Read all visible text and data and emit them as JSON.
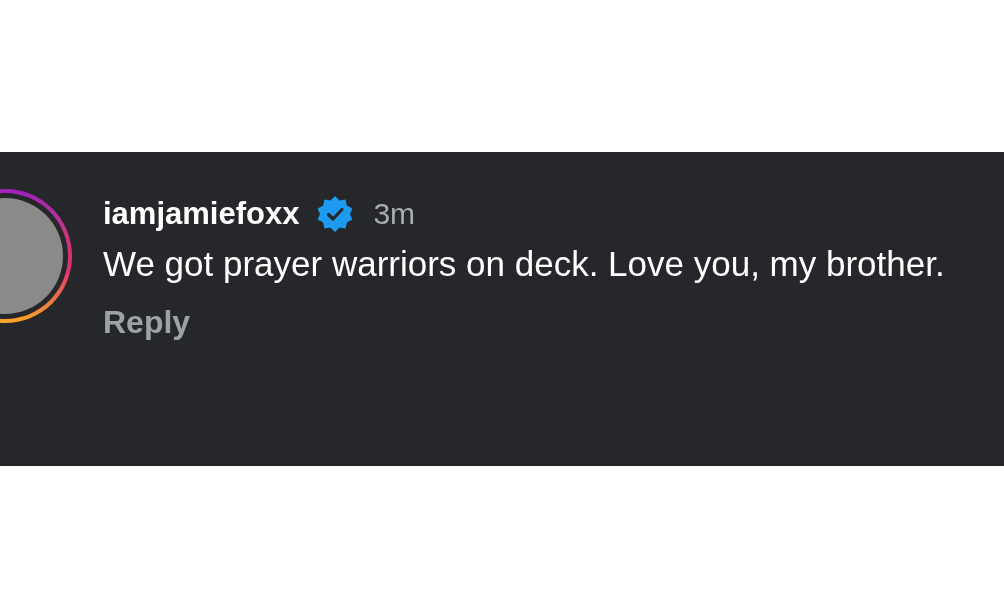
{
  "comment": {
    "username": "iamjamiefoxx",
    "verified": true,
    "has_story": true,
    "time": "3m",
    "text": "We got prayer warriors on deck. Love you, my brother.",
    "reply": "Reply"
  }
}
